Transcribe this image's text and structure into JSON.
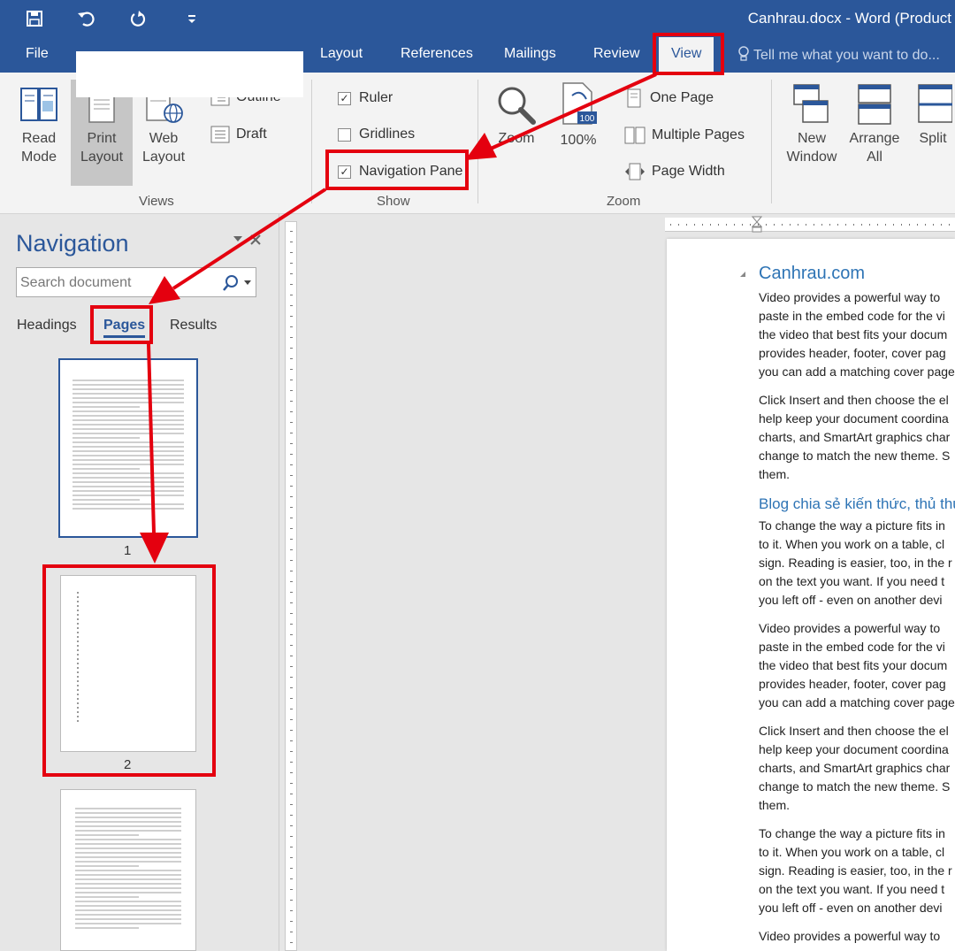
{
  "title_bar": {
    "document_title": "Canhrau.docx - Word (Product"
  },
  "tabs": [
    {
      "label": "File"
    },
    {
      "label": "Layout"
    },
    {
      "label": "References"
    },
    {
      "label": "Mailings"
    },
    {
      "label": "Review"
    },
    {
      "label": "View"
    }
  ],
  "tell_me": "Tell me what you want to do...",
  "ribbon": {
    "views": {
      "read_mode": "Read\nMode",
      "print_layout": "Print\nLayout",
      "web_layout": "Web\nLayout",
      "outline": "Outline",
      "draft": "Draft",
      "group_label": "Views"
    },
    "show": {
      "ruler": "Ruler",
      "gridlines": "Gridlines",
      "navigation_pane": "Navigation Pane",
      "group_label": "Show"
    },
    "zoom": {
      "zoom": "Zoom",
      "hundred": "100%",
      "one_page": "One Page",
      "multiple_pages": "Multiple Pages",
      "page_width": "Page Width",
      "group_label": "Zoom"
    },
    "window": {
      "new_window": "New\nWindow",
      "arrange_all": "Arrange\nAll",
      "split": "Split"
    }
  },
  "navigation": {
    "title": "Navigation",
    "search_placeholder": "Search document",
    "tabs": {
      "headings": "Headings",
      "pages": "Pages",
      "results": "Results"
    },
    "pages": [
      "1",
      "2"
    ]
  },
  "document": {
    "heading1": "Canhrau.com",
    "heading2": "Blog chia sẻ kiến thức, thủ thu",
    "paragraphs": [
      [
        "Video provides a powerful way to",
        "paste in the embed code for the vi",
        "the video that best fits your docum",
        "provides header, footer, cover pag",
        "you can add a matching cover page"
      ],
      [
        "Click Insert and then choose the el",
        "help keep your document coordina",
        "charts, and SmartArt graphics char",
        "change to match the new theme. S",
        "them."
      ],
      [
        "To change the way a picture fits in",
        "to it. When you work on a table, cl",
        "sign. Reading is easier, too, in the r",
        "on the text you want. If you need t",
        "you left off - even on another devi"
      ],
      [
        "Video provides a powerful way to",
        "paste in the embed code for the vi",
        "the video that best fits your docum",
        "provides header, footer, cover pag",
        "you can add a matching cover page"
      ],
      [
        "Click Insert and then choose the el",
        "help keep your document coordina",
        "charts, and SmartArt graphics char",
        "change to match the new theme. S",
        "them."
      ],
      [
        "To change the way a picture fits in",
        "to it. When you work on a table, cl",
        "sign. Reading is easier, too, in the r",
        "on the text you want. If you need t",
        "you left off - even on another devi"
      ],
      [
        "Video provides a powerful way to"
      ]
    ]
  },
  "colors": {
    "accent": "#2b579a",
    "annotation": "#e4000f",
    "heading": "#2e74b5"
  }
}
